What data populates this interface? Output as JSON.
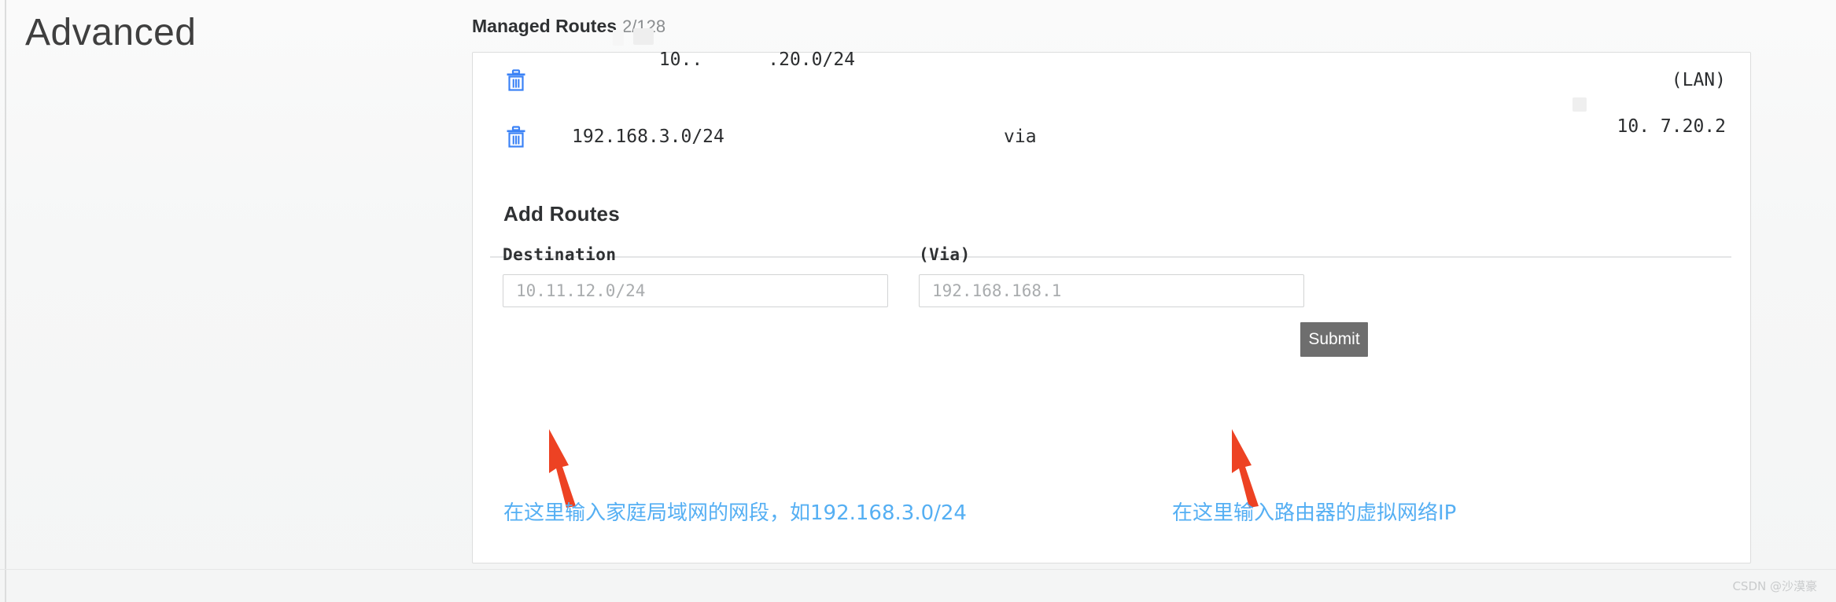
{
  "page": {
    "title": "Advanced"
  },
  "section": {
    "title": "Managed Routes",
    "count": "2/128"
  },
  "routes": {
    "delete_icon": "trash-icon",
    "items": [
      {
        "destination": "10..      .20.0/24",
        "via_label": "",
        "right_label": "(LAN)"
      },
      {
        "destination": "192.168.3.0/24",
        "via_label": "via",
        "right_label": "10. 7.20.2"
      }
    ]
  },
  "add_routes": {
    "title": "Add Routes",
    "destination": {
      "label": "Destination",
      "value": "",
      "placeholder": "10.11.12.0/24"
    },
    "via": {
      "label": "(Via)",
      "value": "",
      "placeholder": "192.168.168.1"
    },
    "submit_label": "Submit"
  },
  "annotations": {
    "accent_color": "#55aff3",
    "arrow_color": "#ed4223",
    "destination_note": "在这里输入家庭局域网的网段，如192.168.3.0/24",
    "via_note": "在这里输入路由器的虚拟网络IP"
  },
  "watermark": {
    "text": "CSDN @沙漠豪"
  }
}
